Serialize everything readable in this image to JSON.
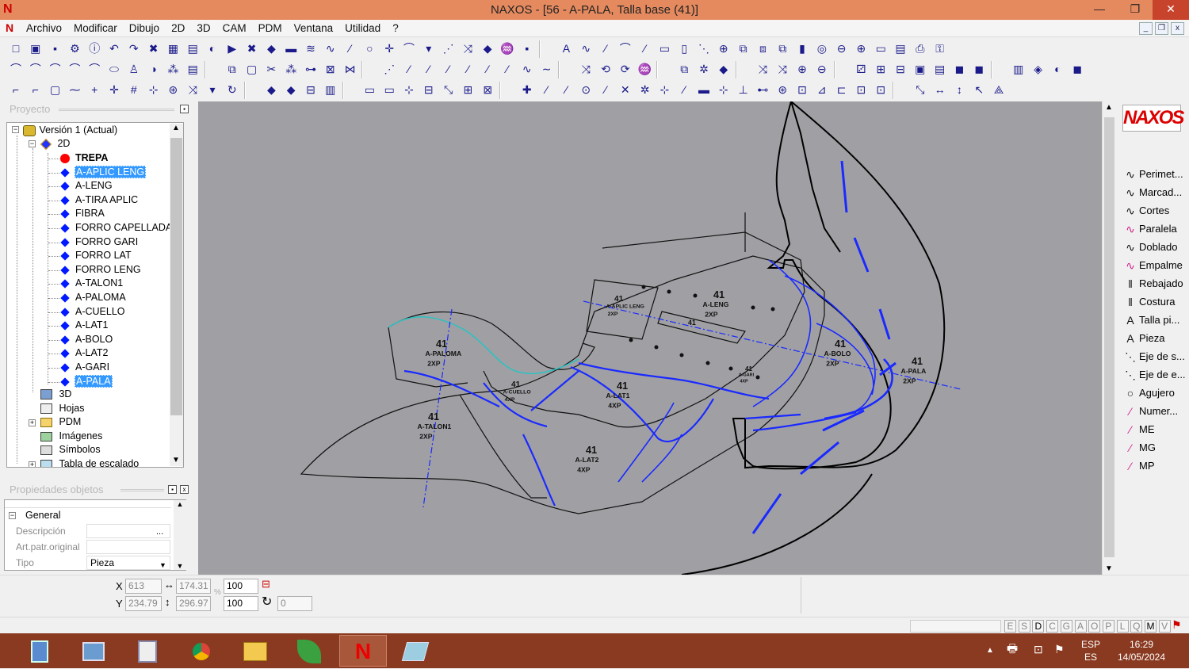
{
  "window": {
    "title": "NAXOS - [56 - A-PALA, Talla base (41)]",
    "logo": "N",
    "minimize": "—",
    "maximize": "❐",
    "close": "✕"
  },
  "menu": [
    "Archivo",
    "Modificar",
    "Dibujo",
    "2D",
    "3D",
    "CAM",
    "PDM",
    "Ventana",
    "Utilidad",
    "?"
  ],
  "mdi_controls": [
    "_",
    "❐",
    "x"
  ],
  "project_panel": {
    "title": "Proyecto",
    "tree": {
      "root": "Versión 1 (Actual)",
      "node_2d": "2D",
      "pieces": [
        "TREPA",
        "A-APLIC LENG",
        "A-LENG",
        "A-TIRA APLIC",
        "FIBRA",
        "FORRO CAPELLADA",
        "FORRO GARI",
        "FORRO LAT",
        "FORRO LENG",
        "A-TALON1",
        "A-PALOMA",
        "A-CUELLO",
        "A-LAT1",
        "A-BOLO",
        "A-LAT2",
        "A-GARI",
        "A-PALA"
      ],
      "others": [
        "3D",
        "Hojas",
        "PDM",
        "Imágenes",
        "Símbolos",
        "Tabla de escalado"
      ]
    }
  },
  "properties_panel": {
    "title": "Propiedades objetos",
    "group": "General",
    "rows": [
      {
        "key": "Descripción",
        "value": ""
      },
      {
        "key": "Art.patr.original",
        "value": ""
      },
      {
        "key": "Tipo",
        "value": "Pieza"
      }
    ],
    "ellipsis": "..."
  },
  "canvas": {
    "labels": [
      {
        "size": "41",
        "name": "A-PALOMA",
        "qty": "2XP"
      },
      {
        "size": "41",
        "name": "A-TALON1",
        "qty": "2XP"
      },
      {
        "size": "41",
        "name": "A-CUELLO",
        "qty": "4XP"
      },
      {
        "size": "41",
        "name": "A-LAT1",
        "qty": "4XP"
      },
      {
        "size": "41",
        "name": "A-LAT2",
        "qty": "4XP"
      },
      {
        "size": "41",
        "name": "A-APLIC LENG",
        "qty": "2XP"
      },
      {
        "size": "41",
        "name": "A-LENG",
        "qty": "2XP"
      },
      {
        "size": "41",
        "name": "A-BOLO",
        "qty": "2XP"
      },
      {
        "size": "41",
        "name": "A-PALA",
        "qty": "2XP"
      },
      {
        "size": "41",
        "name": "A-GARI",
        "qty": "4XP"
      },
      {
        "size": "41",
        "name": "A-TIRA APLIC",
        "qty": ""
      }
    ]
  },
  "right_tools": [
    "Perimet...",
    "Marcad...",
    "Cortes",
    "Paralela",
    "Doblado",
    "Empalme",
    "Rebajado",
    "Costura",
    "Talla pi...",
    "Pieza",
    "Eje de s...",
    "Eje de e...",
    "Agujero",
    "Numer...",
    "ME",
    "MG",
    "MP"
  ],
  "brand_logo": "NAXOS",
  "coords": {
    "x_label": "X",
    "x": "613",
    "y_label": "Y",
    "y": "234.79",
    "width": "174.31",
    "height": "296.97",
    "scale_x": "100",
    "scale_y": "100",
    "rotation": "0",
    "percent": "%"
  },
  "status_keys": [
    "E",
    "S",
    "D",
    "C",
    "G",
    "A",
    "O",
    "P",
    "L",
    "Q",
    "M",
    "V"
  ],
  "tray": {
    "lang1": "ESP",
    "lang2": "ES",
    "time": "16:29",
    "date": "14/05/2024"
  }
}
